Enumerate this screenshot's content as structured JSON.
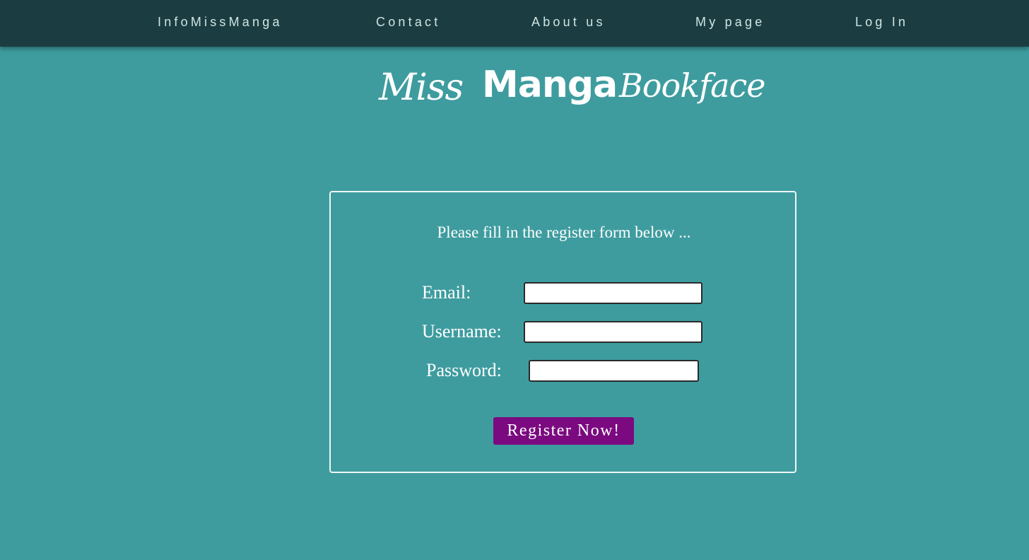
{
  "nav": {
    "items": [
      {
        "label": "InfoMissManga"
      },
      {
        "label": "Contact"
      },
      {
        "label": "About us"
      },
      {
        "label": "My page"
      },
      {
        "label": "Log In"
      }
    ]
  },
  "logo": {
    "part1": "Miss",
    "part2": "Manga",
    "part3": "Bookface"
  },
  "form": {
    "intro": "Please fill in the register form below ...",
    "email_label": "Email:",
    "email_value": "",
    "username_label": "Username:",
    "username_value": "",
    "password_label": "Password:",
    "password_value": "",
    "submit_label": "Register Now!"
  },
  "colors": {
    "background": "#3e9c9f",
    "navbar": "#1b3d41",
    "button": "#7b0a80"
  }
}
